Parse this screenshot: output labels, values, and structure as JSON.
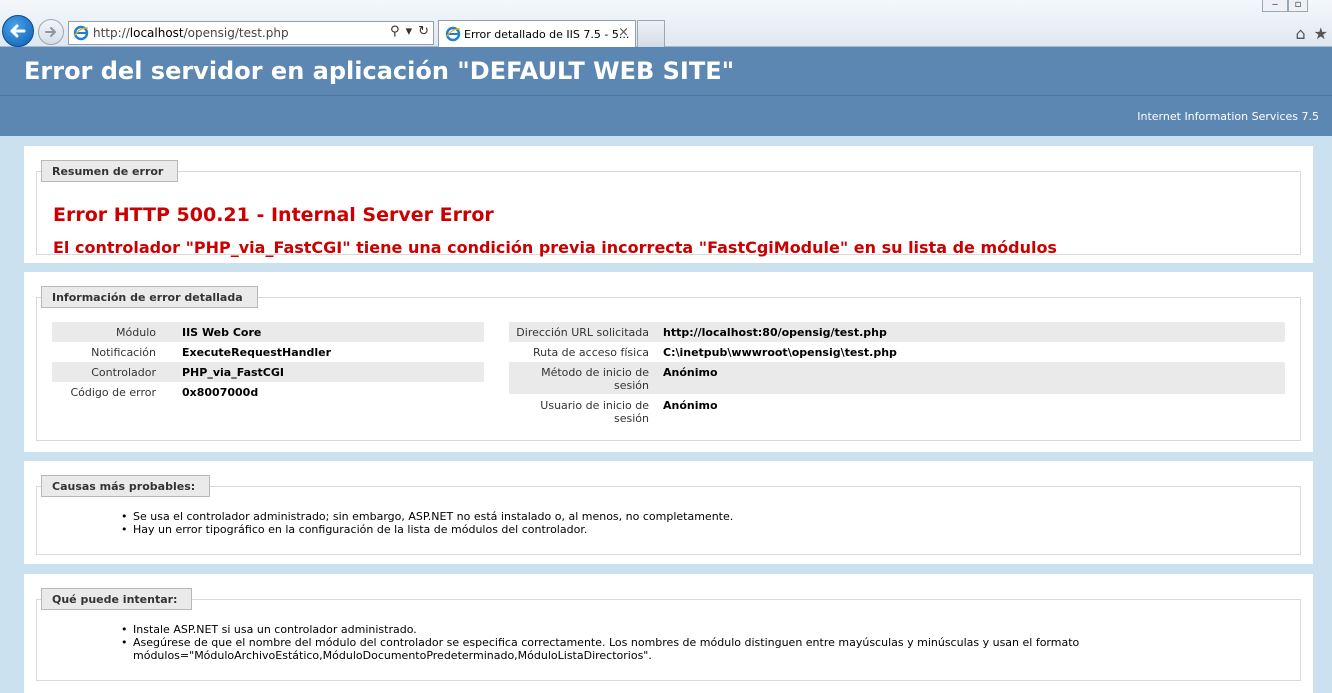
{
  "browser": {
    "url_prefix": "http://",
    "url_host": "localhost",
    "url_path": "/opensig/test.php",
    "tab_title": "Error detallado de IIS 7.5 - 5...",
    "close_glyph": "×",
    "search_glyph": "⚲",
    "dropdown_glyph": "▾",
    "refresh_glyph": "↻",
    "home_glyph": "⌂",
    "star_glyph": "★",
    "minimize_glyph": "‒",
    "restore_glyph": "▫"
  },
  "header": {
    "title": "Error del servidor en aplicación \"DEFAULT WEB SITE\"",
    "server": "Internet Information Services 7.5"
  },
  "summary": {
    "legend": "Resumen de error",
    "error_code": "Error HTTP 500.21 - Internal Server Error",
    "error_message": "El controlador \"PHP_via_FastCGI\" tiene una condición previa incorrecta \"FastCgiModule\" en su lista de módulos"
  },
  "details": {
    "legend": "Información de error detallada",
    "left": [
      {
        "key": "Módulo",
        "value": "IIS Web Core"
      },
      {
        "key": "Notificación",
        "value": "ExecuteRequestHandler"
      },
      {
        "key": "Controlador",
        "value": "PHP_via_FastCGI"
      },
      {
        "key": "Código de error",
        "value": "0x8007000d"
      }
    ],
    "right": [
      {
        "key": "Dirección URL solicitada",
        "value": "http://localhost:80/opensig/test.php"
      },
      {
        "key": "Ruta de acceso física",
        "value": "C:\\inetpub\\wwwroot\\opensig\\test.php"
      },
      {
        "key_line1": "Método de inicio de",
        "key_line2": "sesión",
        "value": "Anónimo"
      },
      {
        "key_line1": "Usuario de inicio de",
        "key_line2": "sesión",
        "value": "Anónimo"
      }
    ]
  },
  "causes": {
    "legend": "Causas más probables:",
    "items": [
      "Se usa el controlador administrado; sin embargo, ASP.NET no está instalado o, al menos, no completamente.",
      "Hay un error tipográfico en la configuración de la lista de módulos del controlador."
    ]
  },
  "actions": {
    "legend": "Qué puede intentar:",
    "items": [
      "Instale ASP.NET si usa un controlador administrado.",
      "Asegúrese de que el nombre del módulo del controlador se especifica correctamente. Los nombres de módulo distinguen entre mayúsculas y minúsculas y usan el formato",
      "módulos=\"MóduloArchivoEstático,MóduloDocumentoPredeterminado,MóduloListaDirectorios\"."
    ]
  },
  "colors": {
    "header_blue": "#5C87B2",
    "page_bg": "#CBE1EF",
    "error_red": "#CC0000"
  }
}
